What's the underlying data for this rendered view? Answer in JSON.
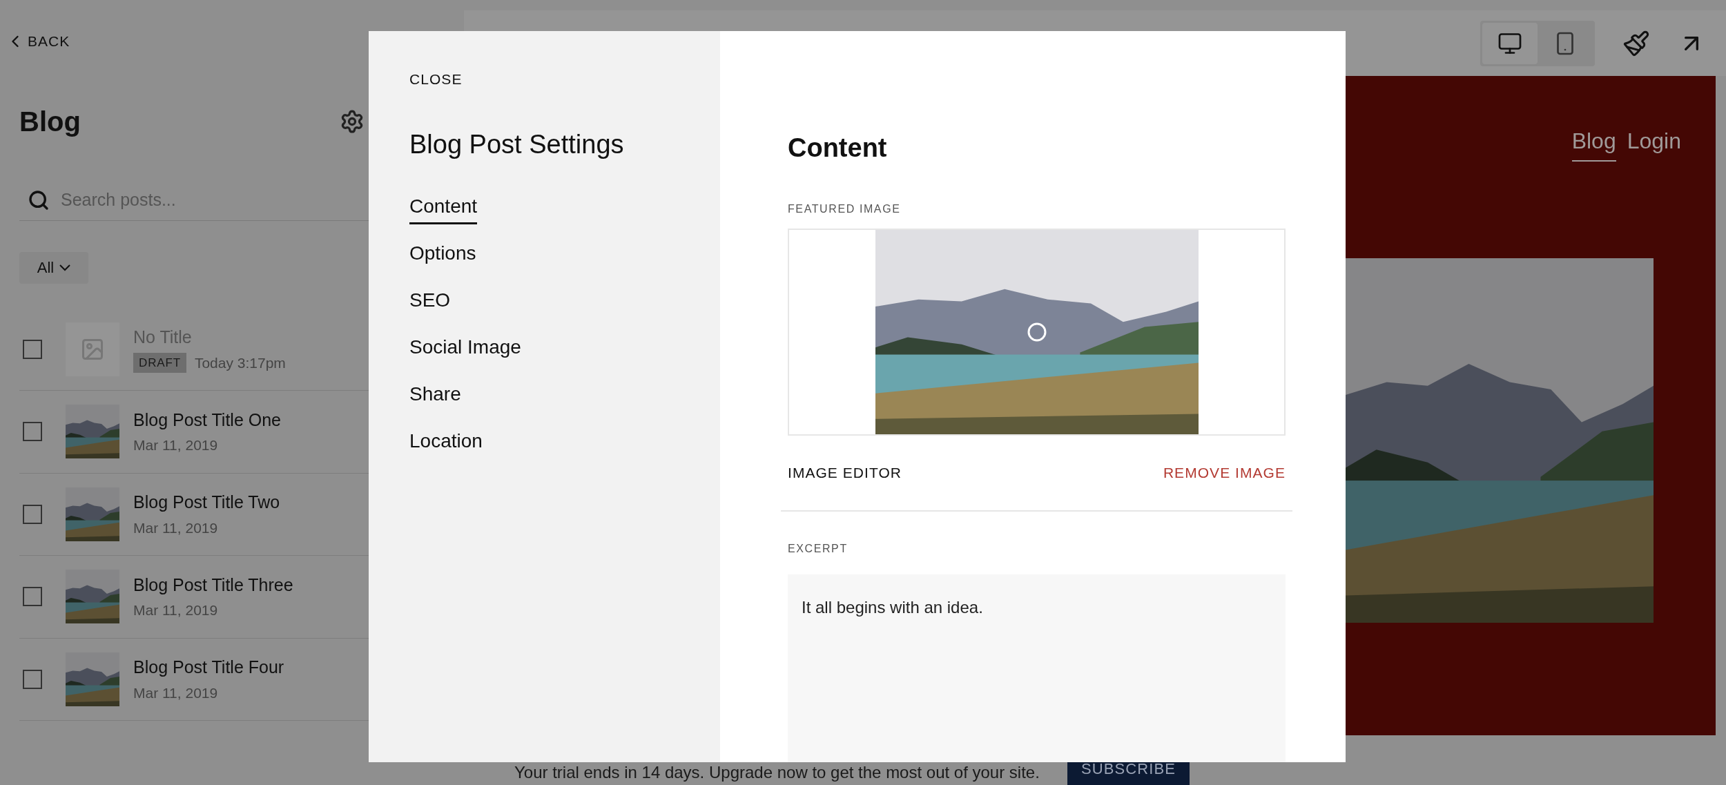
{
  "sidebar": {
    "back": "BACK",
    "title": "Blog",
    "search": {
      "placeholder": "Search posts..."
    },
    "filter": "All",
    "posts": [
      {
        "kind": "draft",
        "title": "No Title",
        "badge": "DRAFT",
        "date": "Today 3:17pm",
        "checked": false
      },
      {
        "kind": "published",
        "title": "Blog Post Title One",
        "date": "Mar 11, 2019",
        "checked": false
      },
      {
        "kind": "published",
        "title": "Blog Post Title Two",
        "date": "Mar 11, 2019",
        "checked": false
      },
      {
        "kind": "published",
        "title": "Blog Post Title Three",
        "date": "Mar 11, 2019",
        "checked": false
      },
      {
        "kind": "published",
        "title": "Blog Post Title Four",
        "date": "Mar 11, 2019",
        "checked": false
      }
    ]
  },
  "preview": {
    "devices": [
      {
        "kind": "desktop",
        "selected": true
      },
      {
        "kind": "mobile",
        "selected": false
      }
    ],
    "nav": [
      {
        "label": "Blog",
        "selected": true
      },
      {
        "label": "Login",
        "selected": false
      }
    ]
  },
  "trial_bar": {
    "message": "Your trial ends in 14 days. Upgrade now to get the most out of your site.",
    "button": "SUBSCRIBE"
  },
  "modal": {
    "close": "CLOSE",
    "title": "Blog Post Settings",
    "nav": [
      {
        "label": "Content",
        "selected": true
      },
      {
        "label": "Options",
        "selected": false
      },
      {
        "label": "SEO",
        "selected": false
      },
      {
        "label": "Social Image",
        "selected": false
      },
      {
        "label": "Share",
        "selected": false
      },
      {
        "label": "Location",
        "selected": false
      }
    ],
    "content": {
      "heading": "Content",
      "featured_image_label": "FEATURED IMAGE",
      "image_editor": "IMAGE EDITOR",
      "remove_image": "REMOVE IMAGE",
      "excerpt_label": "EXCERPT",
      "excerpt": "It all begins with an idea."
    }
  }
}
